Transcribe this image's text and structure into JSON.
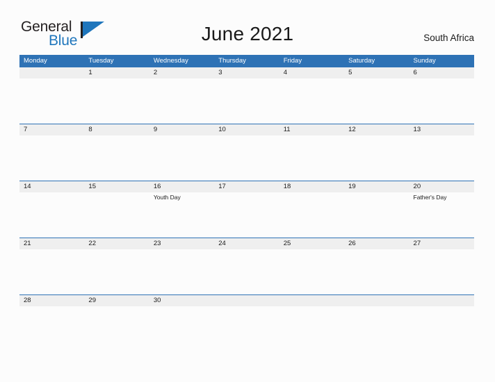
{
  "brand": {
    "line1": "General",
    "line2": "Blue",
    "flag_icon": "blue-flag-triangle",
    "color_dark": "#231f20",
    "color_blue": "#1f76bc"
  },
  "header": {
    "title": "June 2021",
    "region": "South Africa"
  },
  "calendar": {
    "accent_color": "#2e72b5",
    "date_band_color": "#efefef",
    "weekdays": [
      "Monday",
      "Tuesday",
      "Wednesday",
      "Thursday",
      "Friday",
      "Saturday",
      "Sunday"
    ],
    "weeks": [
      {
        "days": [
          {
            "date": "",
            "event": ""
          },
          {
            "date": "1",
            "event": ""
          },
          {
            "date": "2",
            "event": ""
          },
          {
            "date": "3",
            "event": ""
          },
          {
            "date": "4",
            "event": ""
          },
          {
            "date": "5",
            "event": ""
          },
          {
            "date": "6",
            "event": ""
          }
        ]
      },
      {
        "days": [
          {
            "date": "7",
            "event": ""
          },
          {
            "date": "8",
            "event": ""
          },
          {
            "date": "9",
            "event": ""
          },
          {
            "date": "10",
            "event": ""
          },
          {
            "date": "11",
            "event": ""
          },
          {
            "date": "12",
            "event": ""
          },
          {
            "date": "13",
            "event": ""
          }
        ]
      },
      {
        "days": [
          {
            "date": "14",
            "event": ""
          },
          {
            "date": "15",
            "event": ""
          },
          {
            "date": "16",
            "event": "Youth Day"
          },
          {
            "date": "17",
            "event": ""
          },
          {
            "date": "18",
            "event": ""
          },
          {
            "date": "19",
            "event": ""
          },
          {
            "date": "20",
            "event": "Father's Day"
          }
        ]
      },
      {
        "days": [
          {
            "date": "21",
            "event": ""
          },
          {
            "date": "22",
            "event": ""
          },
          {
            "date": "23",
            "event": ""
          },
          {
            "date": "24",
            "event": ""
          },
          {
            "date": "25",
            "event": ""
          },
          {
            "date": "26",
            "event": ""
          },
          {
            "date": "27",
            "event": ""
          }
        ]
      },
      {
        "days": [
          {
            "date": "28",
            "event": ""
          },
          {
            "date": "29",
            "event": ""
          },
          {
            "date": "30",
            "event": ""
          },
          {
            "date": "",
            "event": ""
          },
          {
            "date": "",
            "event": ""
          },
          {
            "date": "",
            "event": ""
          },
          {
            "date": "",
            "event": ""
          }
        ]
      }
    ]
  }
}
